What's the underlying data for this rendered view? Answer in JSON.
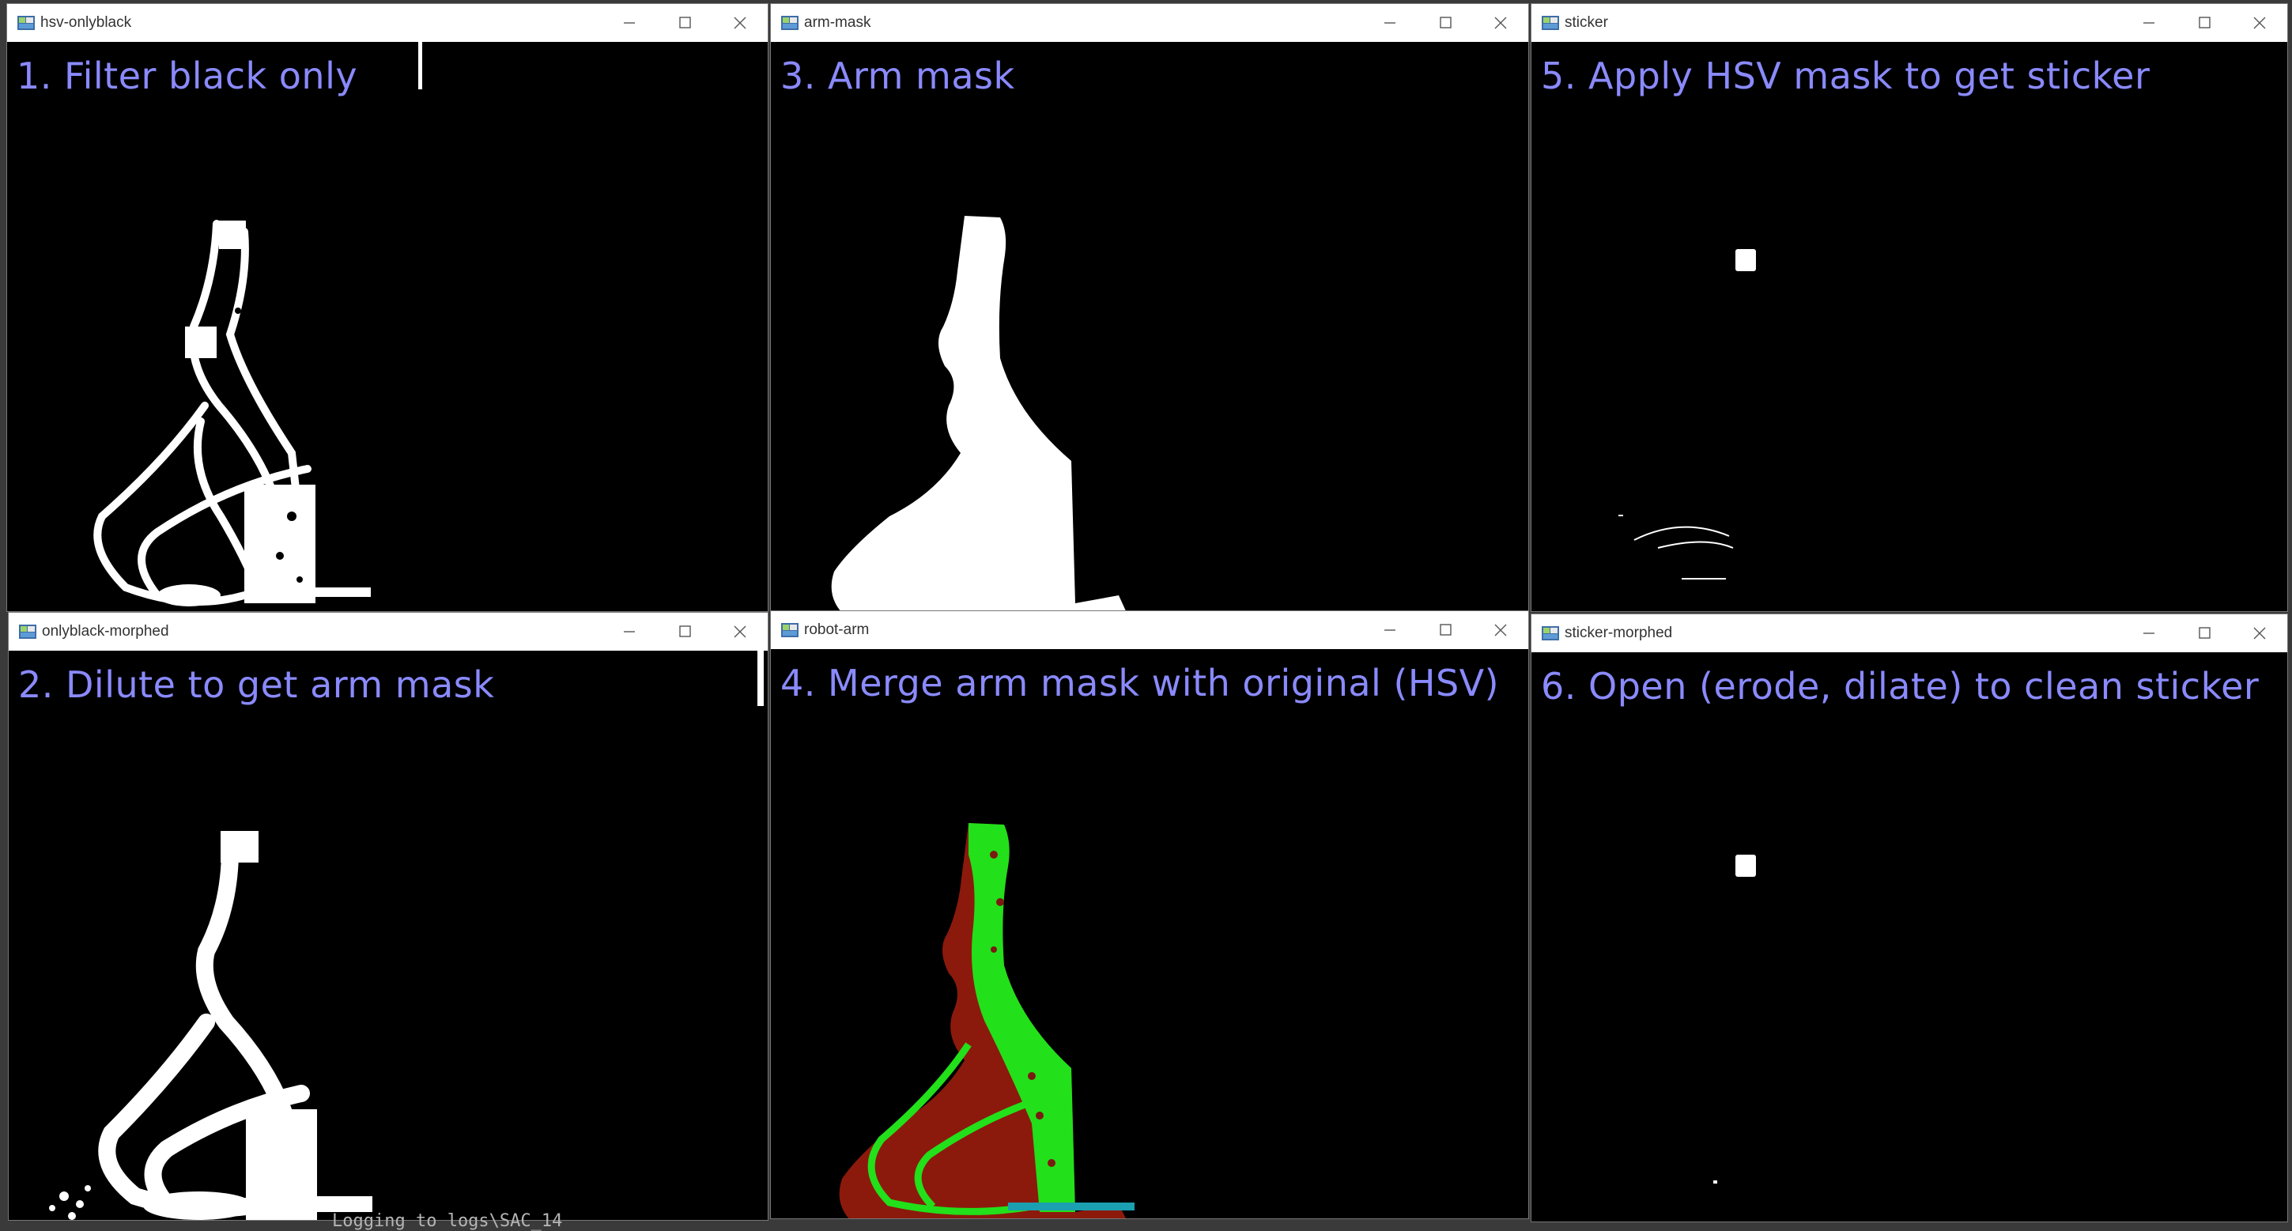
{
  "windows": [
    {
      "title": "hsv-onlyblack",
      "label": "1. Filter black only"
    },
    {
      "title": "arm-mask",
      "label": "3. Arm mask"
    },
    {
      "title": "sticker",
      "label": "5. Apply HSV mask to get sticker"
    },
    {
      "title": "onlyblack-morphed",
      "label": "2. Dilute to get arm mask"
    },
    {
      "title": "robot-arm",
      "label": "4. Merge arm mask with original (HSV)"
    },
    {
      "title": "sticker-morphed",
      "label": "6. Open (erode, dilate) to clean sticker"
    }
  ],
  "background_terminal": {
    "text": "Logging to logs\\SAC_14"
  },
  "colors": {
    "label": "#8a8aff",
    "mask": "#ffffff",
    "arm_green": "#22e01a",
    "arm_red": "#8b1a0c",
    "titlebar": "#ffffff"
  },
  "icons": {
    "app": "opencv-window-icon",
    "minimize": "minimize-icon",
    "maximize": "maximize-icon",
    "close": "close-icon"
  }
}
